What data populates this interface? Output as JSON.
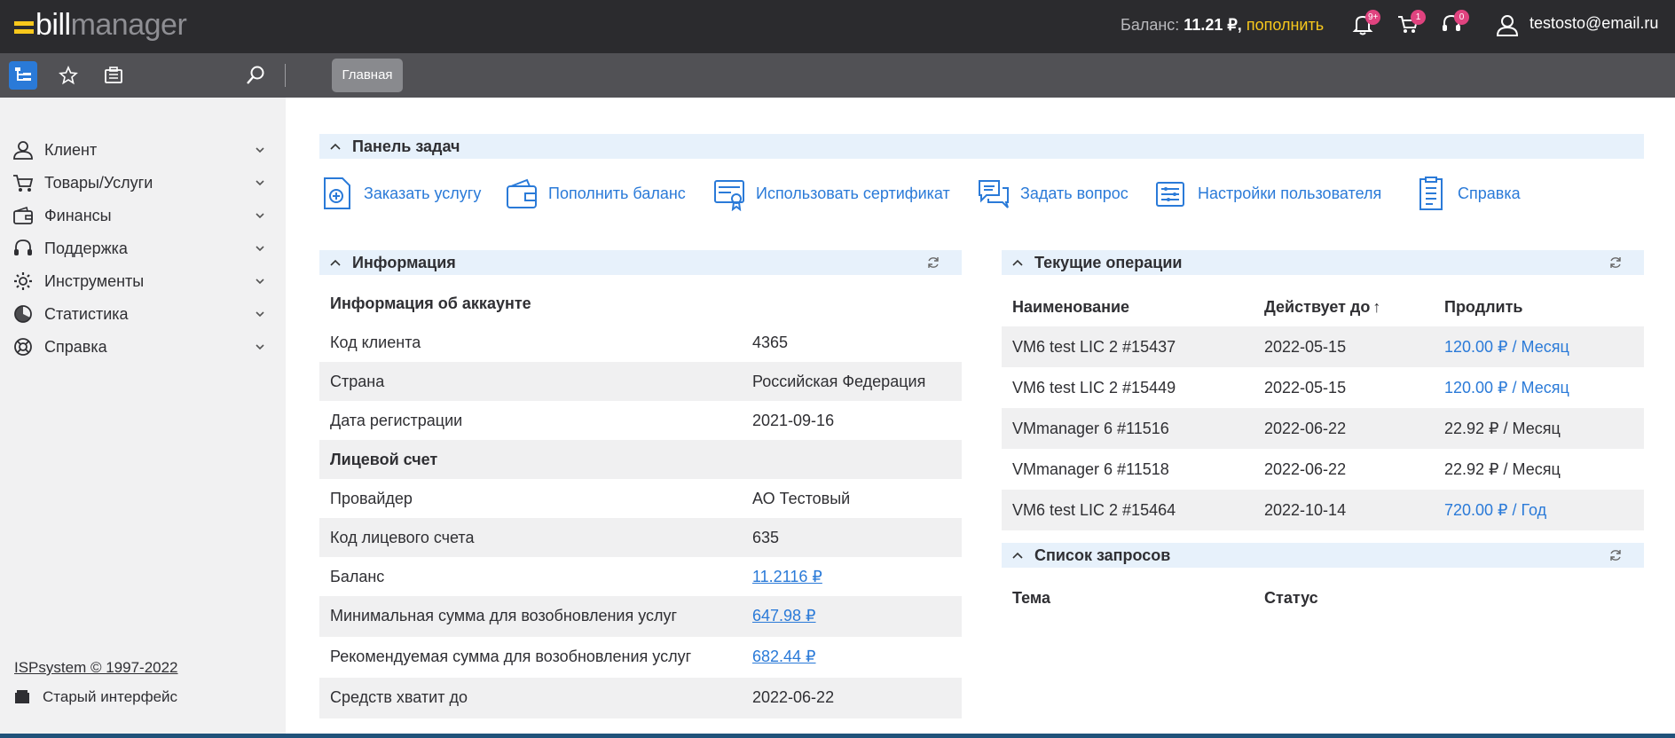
{
  "header": {
    "logo_bill": "bill",
    "logo_manager": "manager",
    "balance_label": "Баланс:",
    "balance_amount": "11.21 ₽,",
    "topup_link": "пополнить",
    "notifications_badge": "9+",
    "cart_badge": "1",
    "alerts_badge": "0",
    "user_email": "testosto@email.ru"
  },
  "toolbar": {
    "home_tab": "Главная"
  },
  "sidebar": {
    "items": [
      {
        "label": "Клиент",
        "icon": "user-icon"
      },
      {
        "label": "Товары/Услуги",
        "icon": "cart-icon"
      },
      {
        "label": "Финансы",
        "icon": "wallet-icon"
      },
      {
        "label": "Поддержка",
        "icon": "headset-icon"
      },
      {
        "label": "Инструменты",
        "icon": "gear-icon"
      },
      {
        "label": "Статистика",
        "icon": "pie-chart-icon"
      },
      {
        "label": "Справка",
        "icon": "lifebuoy-icon"
      }
    ],
    "copyright": "ISPsystem © 1997-2022",
    "old_interface": "Старый интерфейс"
  },
  "tasks_panel": {
    "title": "Панель задач",
    "actions": [
      {
        "label": "Заказать услугу",
        "icon": "order-document-icon"
      },
      {
        "label": "Пополнить баланс",
        "icon": "wallet-icon"
      },
      {
        "label": "Использовать сертификат",
        "icon": "certificate-icon"
      },
      {
        "label": "Задать вопрос",
        "icon": "chat-icon"
      },
      {
        "label": "Настройки пользователя",
        "icon": "settings-list-icon"
      },
      {
        "label": "Справка",
        "icon": "help-document-icon"
      }
    ]
  },
  "info": {
    "title": "Информация",
    "account_section": "Информация об аккаунте",
    "client_code_label": "Код клиента",
    "client_code": "4365",
    "country_label": "Страна",
    "country": "Российская Федерация",
    "reg_date_label": "Дата регистрации",
    "reg_date": "2021-09-16",
    "personal_account_section": "Лицевой счет",
    "provider_label": "Провайдер",
    "provider": "АО Тестовый",
    "account_code_label": "Код лицевого счета",
    "account_code": "635",
    "balance_label": "Баланс",
    "balance": "11.2116 ₽",
    "min_sum_label": "Минимальная сумма для возобновления услуг",
    "min_sum": "647.98 ₽",
    "rec_sum_label": "Рекомендуемая сумма для возобновления услуг",
    "rec_sum": "682.44 ₽",
    "enough_until_label": "Средств хватит до",
    "enough_until": "2022-06-22"
  },
  "operations": {
    "title": "Текущие операции",
    "col_name": "Наименование",
    "col_valid": "Действует до",
    "col_valid_sort": "↑",
    "col_renew": "Продлить",
    "rows": [
      {
        "name": "VM6 test LIC 2 #15437",
        "date": "2022-05-15",
        "price": "120.00 ₽ / Месяц",
        "link": true
      },
      {
        "name": "VM6 test LIC 2 #15449",
        "date": "2022-05-15",
        "price": "120.00 ₽ / Месяц",
        "link": true
      },
      {
        "name": "VMmanager 6 #11516",
        "date": "2022-06-22",
        "price": "22.92 ₽ / Месяц",
        "link": false
      },
      {
        "name": "VMmanager 6 #11518",
        "date": "2022-06-22",
        "price": "22.92 ₽ / Месяц",
        "link": false
      },
      {
        "name": "VM6 test LIC 2 #15464",
        "date": "2022-10-14",
        "price": "720.00 ₽ / Год",
        "link": true
      }
    ]
  },
  "requests": {
    "title": "Список запросов",
    "col_topic": "Тема",
    "col_status": "Статус"
  },
  "colors": {
    "accent": "#2a7ad8",
    "topbar": "#2b2b2e",
    "logo_yellow": "#f8c81c",
    "badge": "#e0437f",
    "section_header": "#e7f1fb"
  }
}
